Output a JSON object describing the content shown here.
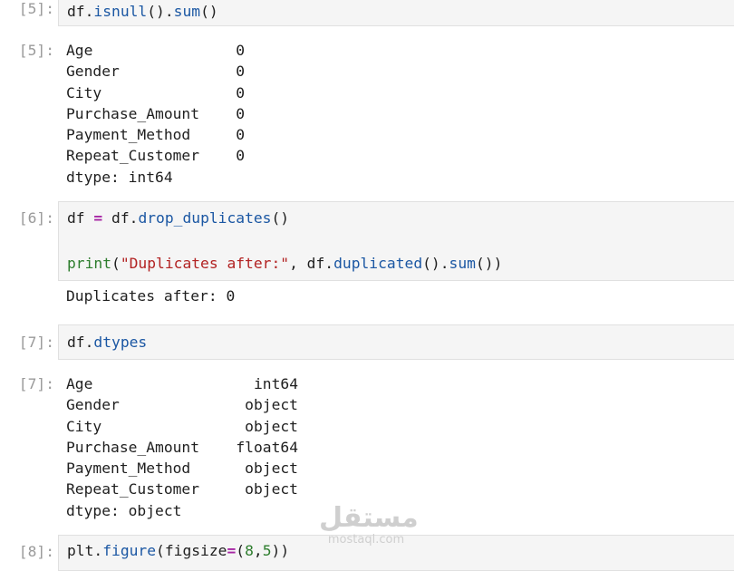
{
  "cells": {
    "c5": {
      "in_prompt": "[5]:",
      "out_prompt": "[5]:",
      "code": {
        "a": "df",
        "b": ".",
        "c": "isnull",
        "d": "().",
        "e": "sum",
        "f": "()"
      },
      "output": {
        "rows": [
          {
            "name": "Age",
            "value": "0"
          },
          {
            "name": "Gender",
            "value": "0"
          },
          {
            "name": "City",
            "value": "0"
          },
          {
            "name": "Purchase_Amount",
            "value": "0"
          },
          {
            "name": "Payment_Method",
            "value": "0"
          },
          {
            "name": "Repeat_Customer",
            "value": "0"
          }
        ],
        "dtype": "dtype: int64"
      }
    },
    "c6": {
      "in_prompt": "[6]:",
      "line1": {
        "a": "df ",
        "op": "=",
        "b": " df.",
        "fn": "drop_duplicates",
        "c": "()"
      },
      "line2": {
        "kw": "print",
        "a": "(",
        "str": "\"Duplicates after:\"",
        "b": ", df.",
        "fn1": "duplicated",
        "c": "().",
        "fn2": "sum",
        "d": "())"
      },
      "output": "Duplicates after: 0"
    },
    "c7": {
      "in_prompt": "[7]:",
      "out_prompt": "[7]:",
      "code": {
        "a": "df.",
        "fn": "dtypes"
      },
      "output": {
        "rows": [
          {
            "name": "Age",
            "value": "int64"
          },
          {
            "name": "Gender",
            "value": "object"
          },
          {
            "name": "City",
            "value": "object"
          },
          {
            "name": "Purchase_Amount",
            "value": "float64"
          },
          {
            "name": "Payment_Method",
            "value": "object"
          },
          {
            "name": "Repeat_Customer",
            "value": "object"
          }
        ],
        "dtype": "dtype: object"
      }
    },
    "c8": {
      "in_prompt": "[8]:",
      "code": {
        "a": "plt.",
        "fn": "figure",
        "b": "(figsize",
        "op": "=",
        "c": "(",
        "n1": "8",
        "d": ",",
        "n2": "5",
        "e": "))"
      }
    }
  },
  "watermark": {
    "arabic": "مستقل",
    "latin": "mostaql.com"
  },
  "colors": {
    "function": "#1b57a3",
    "keyword": "#2d7d2d",
    "string": "#b22222",
    "operator": "#a626a4",
    "prompt": "#9a9a9a",
    "cell_bg": "#f5f5f5"
  }
}
